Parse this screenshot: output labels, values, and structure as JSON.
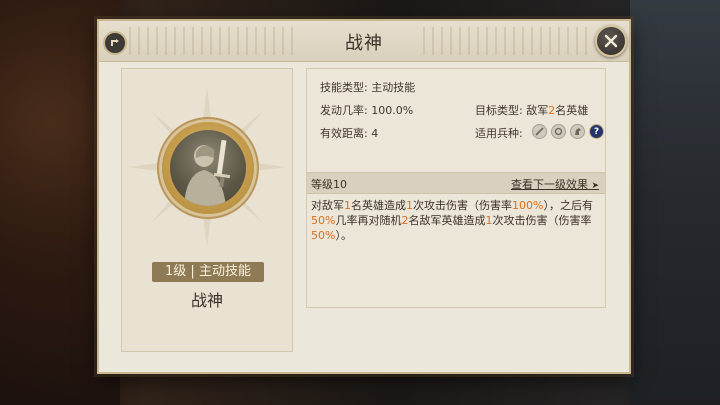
{
  "dialog": {
    "title": "战神"
  },
  "skill": {
    "level_type_tag": "1级 | 主动技能",
    "name": "战神",
    "icon": "warrior-with-sword"
  },
  "info": {
    "skill_type": "技能类型: 主动技能",
    "trigger_rate": "发动几率: 100.0%",
    "effective_range": "有效距离: 4",
    "target_type_prefix": "目标类型: 敌军",
    "target_count": "2",
    "target_type_suffix": "名英雄",
    "applicable_troops_label": "适用兵种:",
    "troop_icons": [
      "sword-icon",
      "shield-icon",
      "horse-icon",
      "question-icon"
    ],
    "question_glyph": "?"
  },
  "level": {
    "label": "等级10",
    "next_effect_link": "查看下一级效果",
    "next_arrow": "➤"
  },
  "description": {
    "parts": [
      "对敌军",
      "1",
      "名英雄造成",
      "1",
      "次攻击伤害（伤害率",
      "100%",
      "），之后有",
      "50%",
      "几率再对随机",
      "2",
      "名敌军英雄造成",
      "1",
      "次攻击伤害（伤害率",
      "50%",
      "）。"
    ]
  },
  "colors": {
    "highlight": "#d8701f",
    "panel": "#ece7db",
    "tag": "#8e7a55"
  }
}
